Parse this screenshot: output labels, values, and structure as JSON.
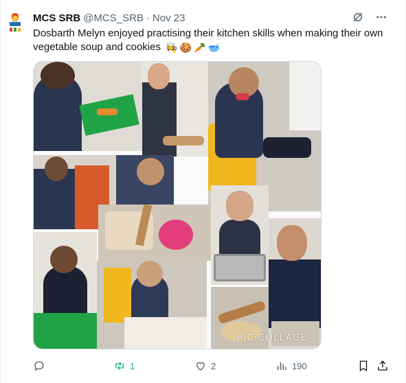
{
  "tweet": {
    "author": "MCS SRB",
    "handle": "@MCS_SRB",
    "separator": "·",
    "date": "Nov 23",
    "text": "Dosbarth Melyn enjoyed practising their kitchen skills when making their own vegetable soup and cookies",
    "emojis": [
      "👩‍🍳",
      "🍪",
      "🥕",
      "🥣"
    ]
  },
  "media": {
    "watermark": "PIC·COLLAGE"
  },
  "actions": {
    "reply_count": "",
    "retweet_count": "1",
    "like_count": "2",
    "views_count": "190"
  },
  "colors": {
    "text": "#0f1419",
    "muted": "#536471",
    "retweet_active": "#00ba7c",
    "border": "#cfd9de"
  }
}
